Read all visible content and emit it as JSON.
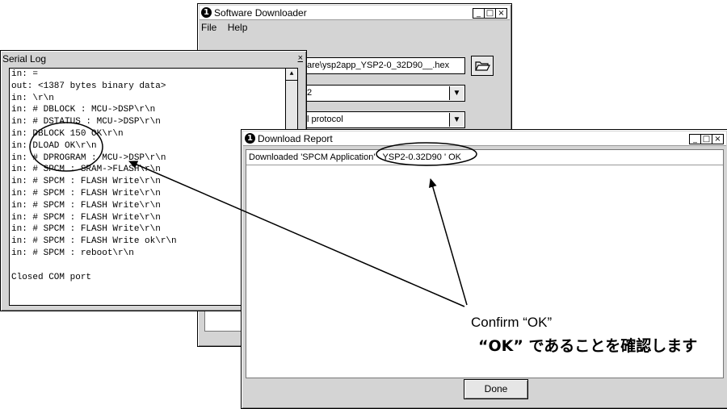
{
  "downloader": {
    "title": "Software Downloader",
    "menu": [
      "File",
      "Help"
    ],
    "file_path": "are\\ysp2app_YSP2-0_32D90__.hex",
    "port_value": "2",
    "protocol_value": "l protocol"
  },
  "serial_log": {
    "title": "Serial Log",
    "lines": [
      "in: =",
      "out: <1387 bytes binary data>",
      "in: \\r\\n",
      "in: # DBLOCK : MCU->DSP\\r\\n",
      "in: # DSTATUS : MCU->DSP\\r\\n",
      "in: DBLOCK 150 OK\\r\\n",
      "in: DLOAD OK\\r\\n",
      "in: # DPROGRAM : MCU->DSP\\r\\n",
      "in: # SPCM : SRAM->FLASH\\r\\n",
      "in: # SPCM : FLASH Write\\r\\n",
      "in: # SPCM : FLASH Write\\r\\n",
      "in: # SPCM : FLASH Write\\r\\n",
      "in: # SPCM : FLASH Write\\r\\n",
      "in: # SPCM : FLASH Write\\r\\n",
      "in: # SPCM : FLASH Write ok\\r\\n",
      "in: # SPCM : reboot\\r\\n",
      "",
      "Closed COM port"
    ]
  },
  "report": {
    "title": "Download Report",
    "message_prefix": "Downloaded 'SPCM Application'",
    "message_version": "YSP2-0.32D90 ' OK",
    "done_label": "Done"
  },
  "annotation": {
    "caption_en": "Confirm “OK”",
    "caption_jp": "“OK” であることを確認します"
  }
}
